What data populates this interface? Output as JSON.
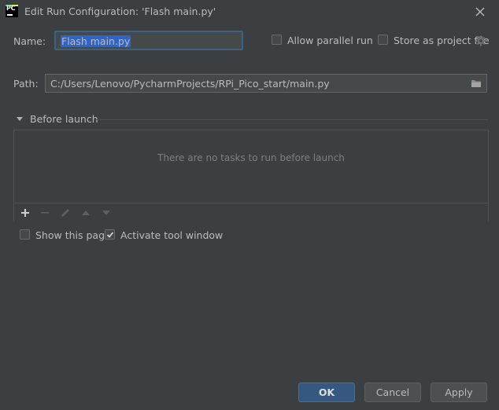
{
  "window": {
    "app_logo_text": "PC",
    "title": "Edit Run Configuration: 'Flash main.py'"
  },
  "form": {
    "name_label": "Name:",
    "name_value": "Flash main.py",
    "allow_parallel_label": "Allow parallel run",
    "allow_parallel_checked": false,
    "store_project_label": "Store as project file",
    "store_project_checked": false,
    "path_label": "Path:",
    "path_value": "C:/Users/Lenovo/PycharmProjects/RPi_Pico_start/main.py"
  },
  "before_launch": {
    "title": "Before launch",
    "empty_message": "There are no tasks to run before launch",
    "toolbar_icons": [
      "add-icon",
      "remove-icon",
      "edit-icon",
      "move-up-icon",
      "move-down-icon"
    ]
  },
  "options": {
    "show_page_label": "Show this page",
    "show_page_checked": false,
    "activate_tool_label": "Activate tool window",
    "activate_tool_checked": true
  },
  "buttons": {
    "ok": "OK",
    "cancel": "Cancel",
    "apply": "Apply"
  },
  "colors": {
    "background": "#3c3f41",
    "primary_button": "#365880",
    "selection": "#2f65ca",
    "text": "#bbbbbb"
  }
}
